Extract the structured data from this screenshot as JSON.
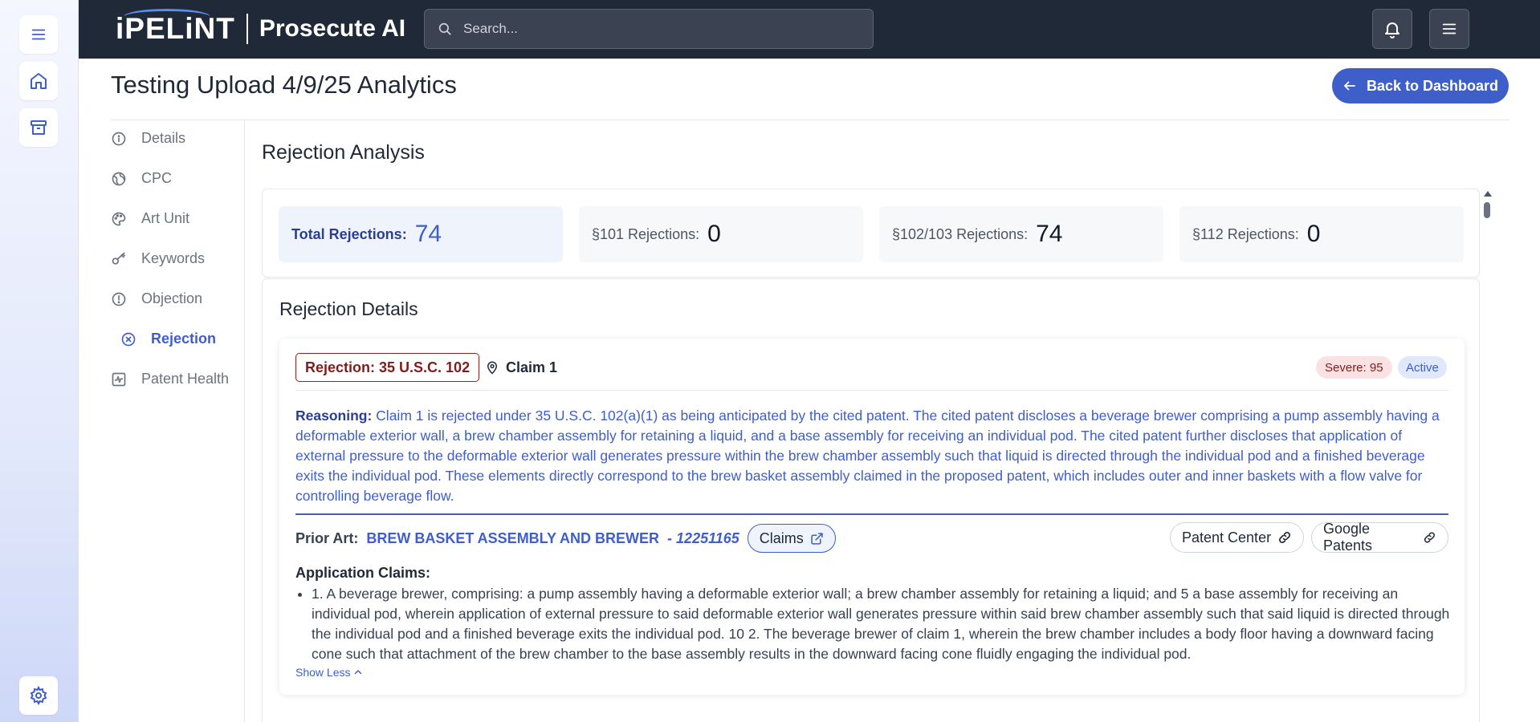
{
  "app": {
    "logo_text": "iPELiNT",
    "product_name": "Prosecute AI"
  },
  "topbar": {
    "search_placeholder": "Search..."
  },
  "header": {
    "title": "Testing Upload 4/9/25 Analytics",
    "back_label": "Back to Dashboard"
  },
  "sidebar": {
    "items": [
      {
        "label": "Details",
        "icon": "info-icon"
      },
      {
        "label": "CPC",
        "icon": "globe-icon"
      },
      {
        "label": "Art Unit",
        "icon": "palette-icon"
      },
      {
        "label": "Keywords",
        "icon": "key-icon"
      },
      {
        "label": "Objection",
        "icon": "alert-circle-icon"
      },
      {
        "label": "Rejection",
        "icon": "x-circle-icon",
        "active": true
      },
      {
        "label": "Patent Health",
        "icon": "activity-icon"
      }
    ]
  },
  "analysis": {
    "title": "Rejection Analysis",
    "stats": [
      {
        "label": "Total Rejections:",
        "value": "74"
      },
      {
        "label": "§101 Rejections:",
        "value": "0"
      },
      {
        "label": "§102/103 Rejections:",
        "value": "74"
      },
      {
        "label": "§112 Rejections:",
        "value": "0"
      }
    ]
  },
  "details": {
    "title": "Rejection Details",
    "card": {
      "rejection_tag": "Rejection: 35 U.S.C. 102",
      "claim": "Claim 1",
      "severity": "Severe: 95",
      "status": "Active",
      "reasoning_label": "Reasoning:",
      "reasoning_text": "Claim 1 is rejected under 35 U.S.C. 102(a)(1) as being anticipated by the cited patent. The cited patent discloses a beverage brewer comprising a pump assembly having a deformable exterior wall, a brew chamber assembly for retaining a liquid, and a base assembly for receiving an individual pod. The cited patent further discloses that application of external pressure to the deformable exterior wall generates pressure within the brew chamber assembly such that liquid is directed through the individual pod and a finished beverage exits the individual pod. These elements directly correspond to the brew basket assembly claimed in the proposed patent, which includes outer and inner baskets with a flow valve for controlling beverage flow.",
      "prior_art_label": "Prior Art:",
      "prior_art_title": "BREW BASKET ASSEMBLY AND BREWER",
      "prior_art_number": "- 12251165",
      "claims_button": "Claims",
      "patent_center_button": "Patent Center",
      "google_patents_button": "Google Patents",
      "app_claims_label": "Application Claims:",
      "app_claims_text": "1. A beverage brewer, comprising: a pump assembly having a deformable exterior wall; a brew chamber assembly for retaining a liquid; and 5 a base assembly for receiving an individual pod, wherein application of external pressure to said deformable exterior wall generates pressure within said brew chamber assembly such that said liquid is directed through the individual pod and a finished beverage exits the individual pod. 10 2. The beverage brewer of claim 1, wherein the brew chamber includes a body floor having a downward facing cone such that attachment of the brew chamber to the base assembly results in the downward facing cone fluidly engaging the individual pod.",
      "show_less": "Show Less"
    }
  },
  "colors": {
    "accent": "#3e5ec9",
    "topbar": "#202938",
    "danger": "#7f1d1d"
  }
}
